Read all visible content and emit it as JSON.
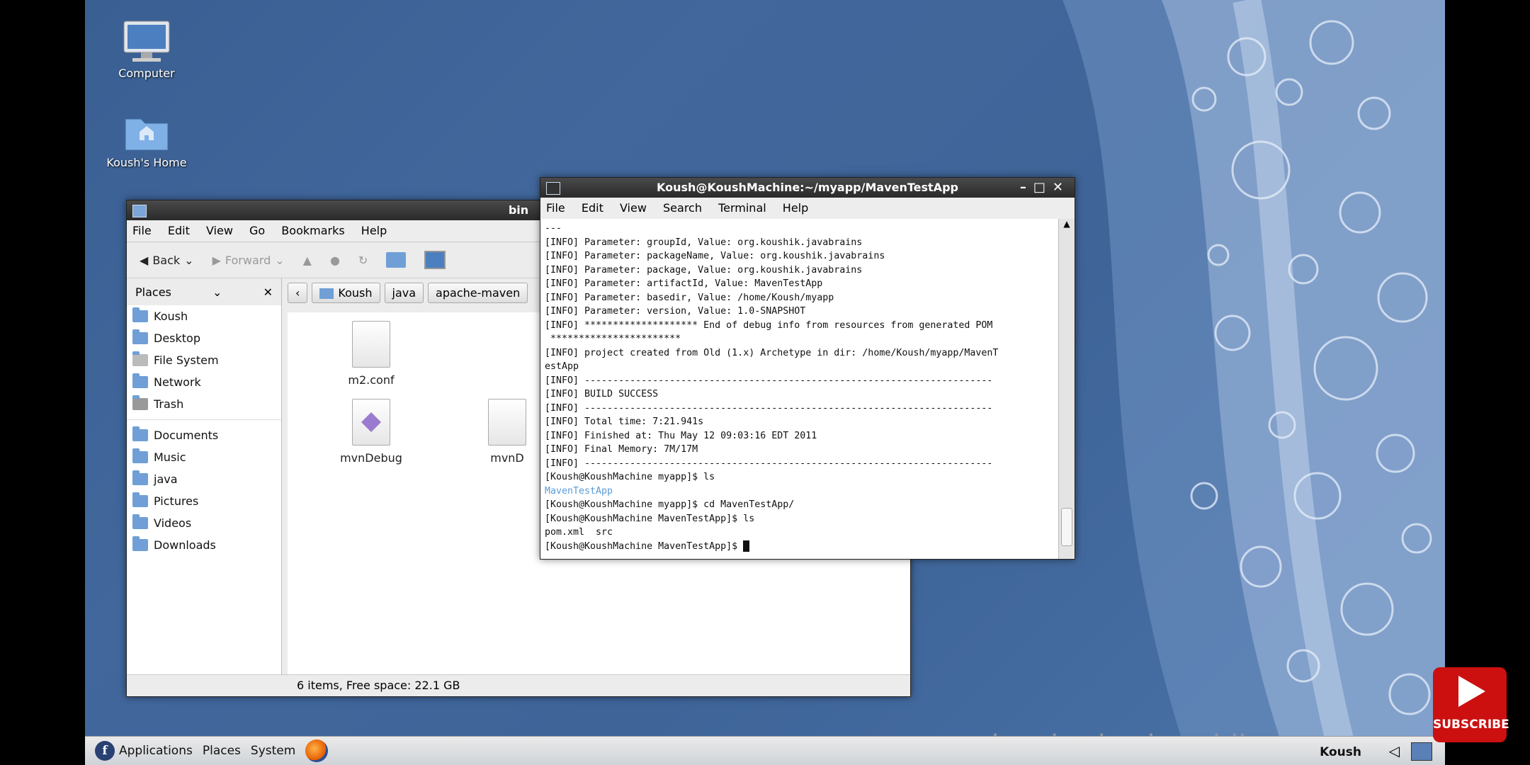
{
  "desktop": {
    "icons": [
      {
        "label": "Computer"
      },
      {
        "label": "Koush's Home"
      }
    ]
  },
  "filemanager": {
    "title": "bin",
    "menu": [
      "File",
      "Edit",
      "View",
      "Go",
      "Bookmarks",
      "Help"
    ],
    "toolbar": {
      "back": "Back",
      "forward": "Forward"
    },
    "places_label": "Places",
    "places": [
      {
        "label": "Koush",
        "icon": "home-folder-icon"
      },
      {
        "label": "Desktop",
        "icon": "folder-icon"
      },
      {
        "label": "File System",
        "icon": "drive-icon"
      },
      {
        "label": "Network",
        "icon": "network-icon"
      },
      {
        "label": "Trash",
        "icon": "trash-icon"
      },
      {
        "label": "Documents",
        "icon": "folder-icon"
      },
      {
        "label": "Music",
        "icon": "folder-icon"
      },
      {
        "label": "java",
        "icon": "folder-icon"
      },
      {
        "label": "Pictures",
        "icon": "folder-icon"
      },
      {
        "label": "Videos",
        "icon": "folder-icon"
      },
      {
        "label": "Downloads",
        "icon": "folder-icon"
      }
    ],
    "path": [
      "Koush",
      "java",
      "apache-maven"
    ],
    "files": [
      {
        "label": "m2.conf"
      },
      {
        "label": "mvnDebug"
      },
      {
        "label": "mvnD"
      }
    ],
    "status": "6 items, Free space: 22.1 GB"
  },
  "terminal": {
    "title": "Koush@KoushMachine:~/myapp/MavenTestApp",
    "menu": [
      "File",
      "Edit",
      "View",
      "Search",
      "Terminal",
      "Help"
    ],
    "lines": [
      "---",
      "[INFO] Parameter: groupId, Value: org.koushik.javabrains",
      "[INFO] Parameter: packageName, Value: org.koushik.javabrains",
      "[INFO] Parameter: package, Value: org.koushik.javabrains",
      "[INFO] Parameter: artifactId, Value: MavenTestApp",
      "[INFO] Parameter: basedir, Value: /home/Koush/myapp",
      "[INFO] Parameter: version, Value: 1.0-SNAPSHOT",
      "[INFO] ******************** End of debug info from resources from generated POM",
      " ***********************",
      "[INFO] project created from Old (1.x) Archetype in dir: /home/Koush/myapp/MavenT",
      "estApp",
      "[INFO] ------------------------------------------------------------------------",
      "[INFO] BUILD SUCCESS",
      "[INFO] ------------------------------------------------------------------------",
      "[INFO] Total time: 7:21.941s",
      "[INFO] Finished at: Thu May 12 09:03:16 EDT 2011",
      "[INFO] Final Memory: 7M/17M",
      "[INFO] ------------------------------------------------------------------------",
      "[Koush@KoushMachine myapp]$ ls",
      "MavenTestApp",
      "[Koush@KoushMachine myapp]$ cd MavenTestApp/",
      "[Koush@KoushMachine MavenTestApp]$ ls",
      "pom.xml  src",
      "[Koush@KoushMachine MavenTestApp]$ "
    ]
  },
  "taskbar": {
    "items": [
      "Applications",
      "Places",
      "System"
    ],
    "user": "Koush"
  },
  "watermark": "javabrains.koushik.org",
  "subscribe": "SUBSCRIBE",
  "colors": {
    "desktop": "#3e6498",
    "link": "#5a9bd6",
    "subscribe": "#cc1010"
  }
}
